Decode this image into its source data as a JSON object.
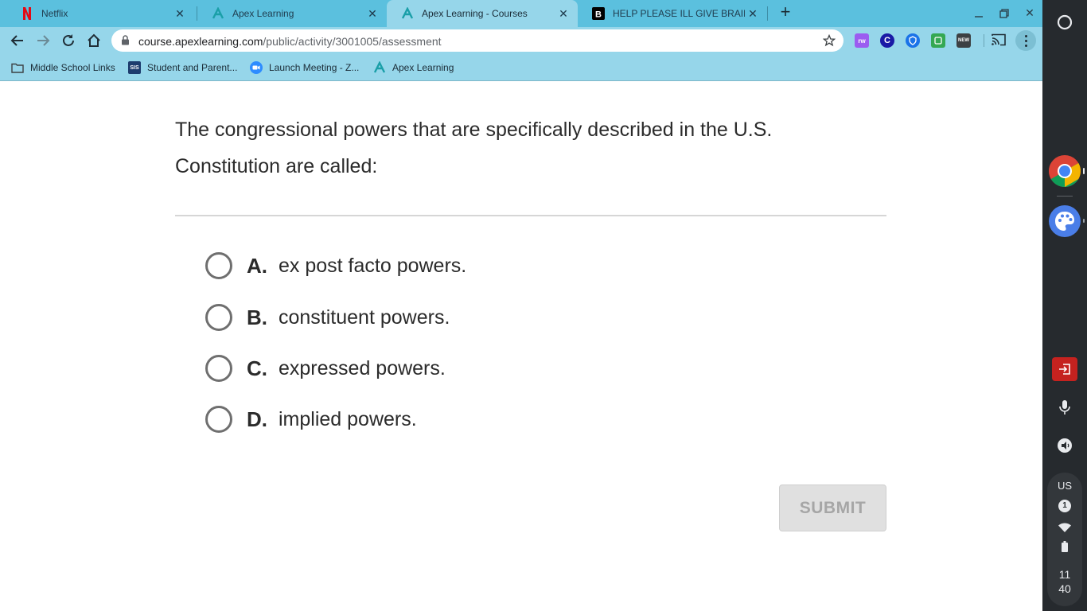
{
  "browser": {
    "tabs": [
      {
        "title": "Netflix",
        "favicon": "netflix-icon",
        "active": false
      },
      {
        "title": "Apex Learning",
        "favicon": "apex-icon",
        "active": false
      },
      {
        "title": "Apex Learning - Courses",
        "favicon": "apex-icon",
        "active": true
      },
      {
        "title": "HELP PLEASE ILL GIVE BRAINLIE",
        "favicon": "brainly-icon",
        "active": false
      }
    ],
    "omnibox": {
      "domain": "course.apexlearning.com",
      "path": "/public/activity/3001005/assessment"
    },
    "extensions": [
      {
        "name": "puzzle-extension-icon",
        "label": "rw",
        "color": "#9b5cf0"
      },
      {
        "name": "c-extension-icon",
        "label": "C",
        "color": "#1a1aa6"
      },
      {
        "name": "shield-extension-icon",
        "label": "",
        "color": "#1a73e8"
      },
      {
        "name": "green-extension-icon",
        "label": "",
        "color": "#34a853"
      },
      {
        "name": "new-extension-icon",
        "label": "NEW",
        "color": "#3c4043"
      }
    ],
    "bookmarks": [
      {
        "label": "Middle School Links",
        "icon": "folder-icon"
      },
      {
        "label": "Student and Parent...",
        "icon": "sis-icon"
      },
      {
        "label": "Launch Meeting - Z...",
        "icon": "zoom-icon"
      },
      {
        "label": "Apex Learning",
        "icon": "apex-icon"
      }
    ],
    "bookmark_sis_text": "SIS"
  },
  "question": {
    "text": "The congressional powers that are specifically described in the U.S. Constitution are called:",
    "options": [
      {
        "letter": "A.",
        "text": "ex post facto powers."
      },
      {
        "letter": "B.",
        "text": "constituent powers."
      },
      {
        "letter": "C.",
        "text": "expressed powers."
      },
      {
        "letter": "D.",
        "text": "implied powers."
      }
    ],
    "submit_label": "SUBMIT"
  },
  "shelf": {
    "apps": [
      "chrome-icon",
      "palette-icon"
    ],
    "tray": {
      "locale": "US",
      "notification_count": "1",
      "clock_hour": "11",
      "clock_minute": "40"
    }
  },
  "colors": {
    "tab_strip": "#5bc0de",
    "toolbar": "#96d6ea",
    "shelf": "#262a2e"
  }
}
